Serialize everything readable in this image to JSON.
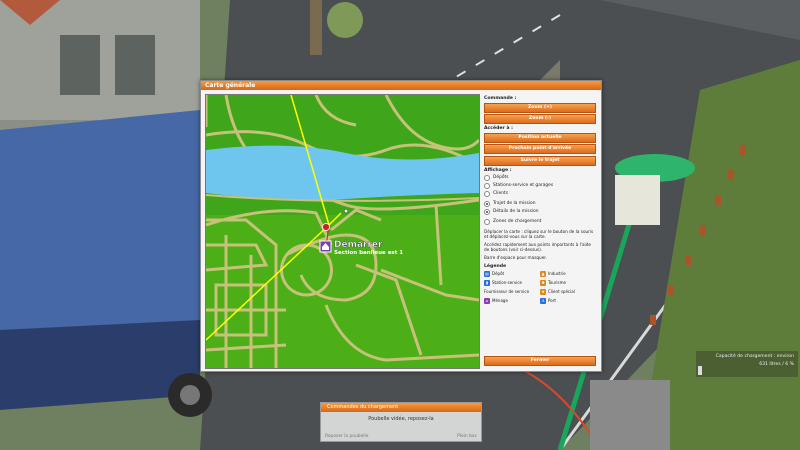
{
  "map_panel": {
    "title": "Carte générale",
    "map_labels": {
      "start": "Démarrer",
      "location": "Section banlieue est 1"
    }
  },
  "sidebar": {
    "commande": {
      "heading": "Commande :",
      "zoom_in": "Zoom (+)",
      "zoom_out": "Zoom (-)"
    },
    "acceder": {
      "heading": "Accéder à :",
      "position": "Position actuelle",
      "next_point": "Prochain point d'arrivée",
      "follow": "Suivre le trajet"
    },
    "affichage": {
      "heading": "Affichage :",
      "options": [
        {
          "label": "Dépôts",
          "checked": false
        },
        {
          "label": "Stations-service et garages",
          "checked": false
        },
        {
          "label": "Clients",
          "checked": false
        },
        {
          "label": "Trajet de la mission",
          "checked": true
        },
        {
          "label": "Détails de la mission",
          "checked": true
        },
        {
          "label": "Zones de chargement",
          "checked": false
        }
      ]
    },
    "help": {
      "move": "Déplacer la carte : cliquez sur le bouton de la souris et déplacez-vous sur la carte.",
      "points": "Accédez rapidement aux points importants à l'aide de boutons (voir ci-dessus).",
      "space": "Barre d'espace pour masquer."
    },
    "legende": {
      "heading": "Légende",
      "items": [
        {
          "label": "Dépôt",
          "icon": "depot-icon",
          "color": "#2a6fd6"
        },
        {
          "label": "Industrie",
          "icon": "industry-icon",
          "color": "#e08a1c"
        },
        {
          "label": "Station-service",
          "icon": "fuel-station-icon",
          "color": "#2a6fd6"
        },
        {
          "label": "Tourisme",
          "icon": "tourism-icon",
          "color": "#e08a1c"
        },
        {
          "label": "Fournisseur de service",
          "icon": "",
          "color": ""
        },
        {
          "label": "Client spécial",
          "icon": "special-client-icon",
          "color": "#e08a1c"
        },
        {
          "label": "Ménage",
          "icon": "household-icon",
          "color": "#8a3fb0"
        },
        {
          "label": "Port",
          "icon": "port-icon",
          "color": "#2a6fd6"
        }
      ]
    },
    "close": "Fermer"
  },
  "cargo_panel": {
    "title": "Commandes du chargement",
    "value": "Poubelle vidée, reposez-la",
    "left_hint": "Reposer la poubelle",
    "right_hint": "Plein bac"
  },
  "capacity": {
    "label": "Capacité de chargement : environ",
    "value": "631 litres / 6 %"
  },
  "colors": {
    "accent": "#e47a26",
    "map_green": "#4caf17",
    "river": "#6ec6ef",
    "road": "#c7c27a",
    "route": "#ffff00"
  }
}
